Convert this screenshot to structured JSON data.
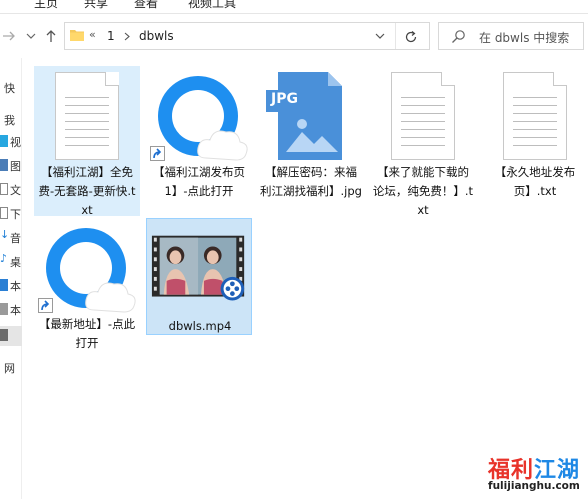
{
  "ribbon": {
    "tabs": [
      {
        "label": "主页"
      },
      {
        "label": "共享"
      },
      {
        "label": "查看"
      },
      {
        "label": "视频工具"
      }
    ]
  },
  "address": {
    "overflow": "«",
    "crumbs": [
      "1",
      "dbwls"
    ],
    "search_placeholder": "在 dbwls 中搜索"
  },
  "sidebar": {
    "items": [
      {
        "label": "快",
        "icon": "quick-access-star-icon",
        "color": "#1f7fd6"
      },
      {
        "label": "我",
        "icon": "this-pc-icon",
        "color": "#2a7fd4"
      },
      {
        "label": "视",
        "icon": "cube-3d-icon",
        "color": "#27a7e0"
      },
      {
        "label": "图",
        "icon": "pictures-icon",
        "color": "#4b7db7"
      },
      {
        "label": "文",
        "icon": "documents-icon",
        "color": "#7a7a7a"
      },
      {
        "label": "下",
        "icon": "downloads-icon",
        "color": "#1f7fd6"
      },
      {
        "label": "音",
        "icon": "music-icon",
        "color": "#1f7fd6"
      },
      {
        "label": "桌",
        "icon": "desktop-icon",
        "color": "#1f7fd6"
      },
      {
        "label": "本",
        "icon": "drive-c-icon",
        "color": "#6b6b6b"
      },
      {
        "label": "本",
        "icon": "drive-d-icon",
        "color": "#6b6b6b"
      },
      {
        "label": "网",
        "icon": "network-icon",
        "color": "#777777"
      }
    ]
  },
  "files": [
    {
      "name": "【福利江湖】全免费-无套路-更新快.txt",
      "type": "txt"
    },
    {
      "name": "【福利江湖发布页1】-点此打开",
      "type": "shortcut"
    },
    {
      "name": "【解压密码：来福利江湖找福利】.jpg",
      "type": "jpg",
      "badge": "JPG"
    },
    {
      "name": "【来了就能下载的论坛，纯免费！】.txt",
      "type": "txt"
    },
    {
      "name": "【永久地址发布页】.txt",
      "type": "txt"
    },
    {
      "name": "【最新地址】-点此打开",
      "type": "shortcut"
    },
    {
      "name": "dbwls.mp4",
      "type": "video"
    }
  ],
  "watermark": {
    "title_a": "福利",
    "title_b": "江湖",
    "url": "fulijianghu.com"
  },
  "colors": {
    "selection": "#cce4f7",
    "selection_border": "#99d1ff",
    "hover": "#dbeefc",
    "browser_blue": "#1e8ff0",
    "jpg_blue": "#4a90d9"
  }
}
